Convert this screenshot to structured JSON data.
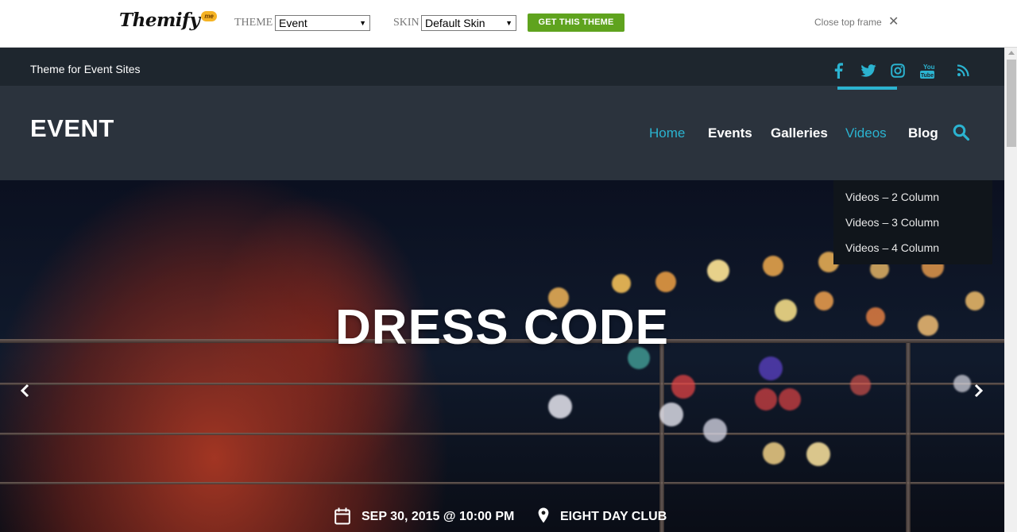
{
  "topframe": {
    "logo_text": "Themify",
    "logo_badge": "me",
    "theme_label": "THEME",
    "theme_value": "Event",
    "skin_label": "SKIN",
    "skin_value": "Default Skin",
    "get_button": "GET THIS THEME",
    "close_label": "Close top frame",
    "close_icon": "close-x-icon"
  },
  "site": {
    "tagline": "Theme for Event Sites",
    "title": "EVENT",
    "social": [
      {
        "name": "facebook-icon"
      },
      {
        "name": "twitter-icon"
      },
      {
        "name": "instagram-icon"
      },
      {
        "name": "youtube-icon"
      },
      {
        "name": "rss-icon"
      }
    ],
    "nav": [
      {
        "label": "Home",
        "active": true
      },
      {
        "label": "Events",
        "active": false
      },
      {
        "label": "Galleries",
        "active": false
      },
      {
        "label": "Videos",
        "active": true
      },
      {
        "label": "Blog",
        "active": false
      }
    ],
    "dropdown": [
      {
        "label": "Videos – 2 Column"
      },
      {
        "label": "Videos – 3 Column"
      },
      {
        "label": "Videos – 4 Column"
      }
    ],
    "colors": {
      "accent": "#2bb3d0",
      "header_bg": "#2b333d",
      "tagbar_bg": "#1e262e",
      "button_green": "#5fa31e"
    }
  },
  "hero": {
    "title": "DRESS CODE",
    "date": "SEP 30, 2015 @ 10:00 PM",
    "place": "EIGHT DAY CLUB"
  }
}
